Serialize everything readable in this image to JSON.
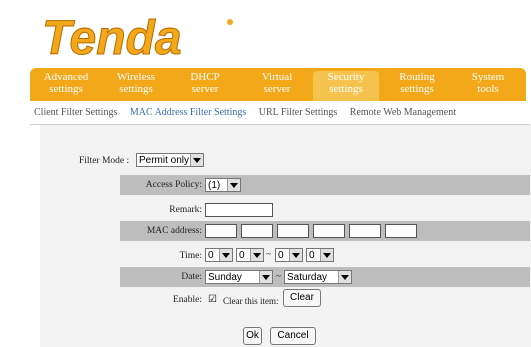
{
  "brand": {
    "name": "Tenda"
  },
  "nav": [
    {
      "line1": "Advanced",
      "line2": "settings"
    },
    {
      "line1": "Wireless",
      "line2": "settings"
    },
    {
      "line1": "DHCP",
      "line2": "server"
    },
    {
      "line1": "Virtual",
      "line2": "server"
    },
    {
      "line1": "Security",
      "line2": "settings"
    },
    {
      "line1": "Routing",
      "line2": "settings"
    },
    {
      "line1": "System",
      "line2": "tools"
    }
  ],
  "subnav": [
    "Client Filter Settings",
    "MAC Address Filter Settings",
    "URL Filter Settings",
    "Remote Web Management"
  ],
  "form": {
    "filter_mode_label": "Filter Mode :",
    "filter_mode_value": "Permit only",
    "access_policy_label": "Access Policy:",
    "access_policy_value": "(1)",
    "remark_label": "Remark:",
    "mac_label": "MAC address:",
    "time_label": "Time:",
    "time_values": [
      "0",
      "0",
      "0",
      "0"
    ],
    "time_sep": "~",
    "date_label": "Date:",
    "date_from": "Sunday",
    "date_to": "Saturday",
    "date_sep": "~",
    "enable_label": "Enable:",
    "enable_checked": "☑",
    "clear_item_label": "Clear this item:",
    "clear_button": "Clear",
    "ok_button": "Ok",
    "cancel_button": "Cancel"
  },
  "colors": {
    "accent": "#f3a81a",
    "link": "#3b6db0",
    "row": "#bdbdbd"
  }
}
